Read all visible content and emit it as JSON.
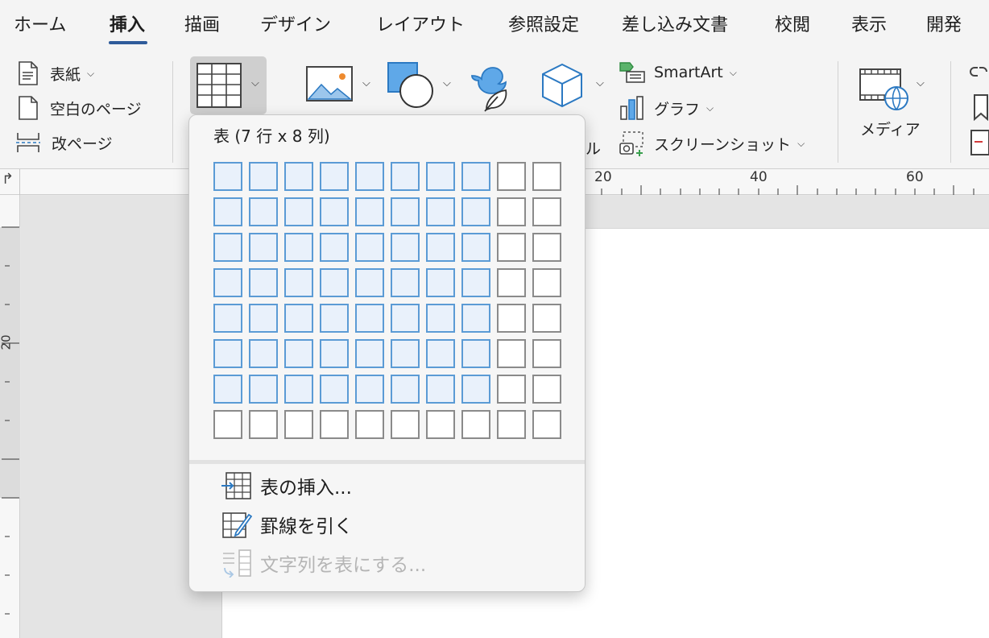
{
  "tabs": [
    "ホーム",
    "挿入",
    "描画",
    "デザイン",
    "レイアウト",
    "参照設定",
    "差し込み文書",
    "校閲",
    "表示",
    "開発"
  ],
  "active_tab": "挿入",
  "ribbon": {
    "pages_group": {
      "cover": "表紙",
      "blank_page": "空白のページ",
      "page_break": "改ページ"
    },
    "smartart": "SmartArt",
    "graph": "グラフ",
    "screenshot": "スクリーンショット",
    "partial_label": "ル",
    "media": "メディア"
  },
  "ruler": {
    "horizontal": [
      "20",
      "40",
      "60"
    ],
    "vertical": [
      "20"
    ]
  },
  "table_menu": {
    "title": "表 (7 行 x 8 列)",
    "grid": {
      "rows": 8,
      "cols": 10,
      "selected_rows": 7,
      "selected_cols": 8
    },
    "items": [
      {
        "label": "表の挿入...",
        "enabled": true,
        "icon": "insert-table-icon"
      },
      {
        "label": "罫線を引く",
        "enabled": true,
        "icon": "draw-table-icon"
      },
      {
        "label": "文字列を表にする...",
        "enabled": false,
        "icon": "convert-text-to-table-icon"
      }
    ]
  },
  "colors": {
    "accent": "#2e5b9a",
    "selected_cell_fill": "#e9f1fb",
    "selected_cell_border": "#5b9bd5",
    "icon_blue": "#2b79c2"
  }
}
